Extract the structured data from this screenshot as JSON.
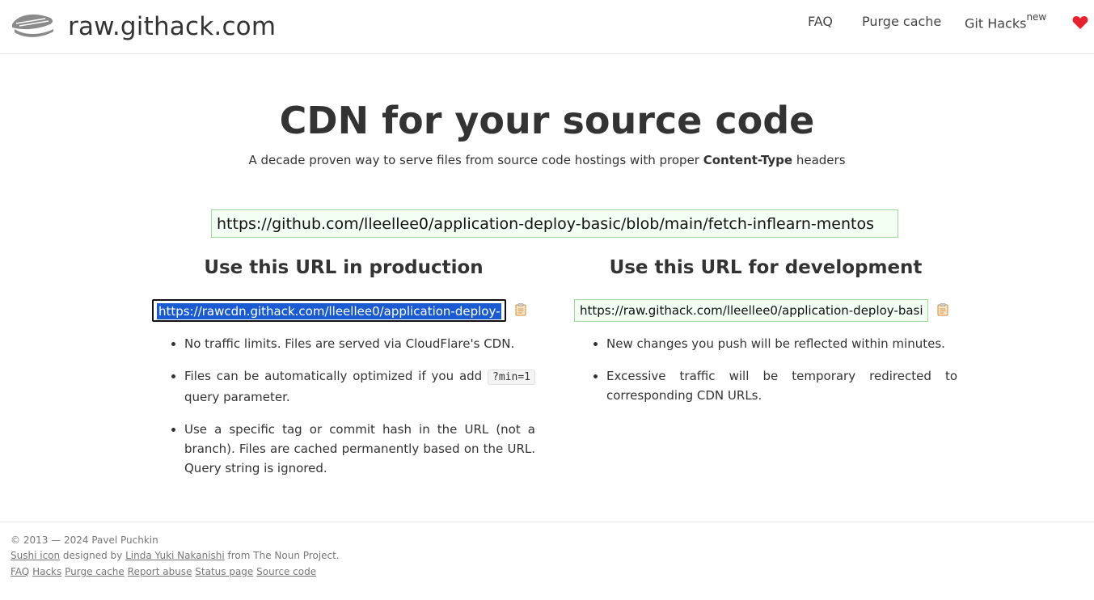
{
  "header": {
    "brand": "raw.githack.com",
    "nav": {
      "faq": "FAQ",
      "purge": "Purge cache",
      "git_hacks": "Git Hacks",
      "git_hacks_badge": "new"
    },
    "heart_color": "#e8212e"
  },
  "hero": {
    "title_bold": "CDN",
    "title_rest": " for your source code",
    "subtitle_pre": "A decade proven way to serve files from source code hostings with proper ",
    "subtitle_bold": "Content-Type",
    "subtitle_post": " headers"
  },
  "main_input": {
    "value": "https://github.com/lleellee0/application-deploy-basic/blob/main/fetch-inflearn-mentos"
  },
  "production": {
    "title": "Use this URL in production",
    "url": "https://rawcdn.githack.com/lleellee0/application-deploy-",
    "bullets": [
      "No traffic limits. Files are served via CloudFlare's CDN.",
      "Files can be automatically optimized if you add ",
      "Use a specific tag or commit hash in the URL (not a branch). Files are cached permanently based on the URL. Query string is ignored."
    ],
    "min_code": "?min=1",
    "min_suffix": " query parameter."
  },
  "development": {
    "title": "Use this URL for development",
    "url": "https://raw.githack.com/lleellee0/application-deploy-basi",
    "bullets": [
      "New changes you push will be reflected within minutes.",
      "Excessive traffic will be temporary redirected to corresponding CDN URLs."
    ]
  },
  "footer": {
    "copyright": "© 2013 — 2024 ",
    "author": "Pavel Puchkin",
    "sushi_icon": "Sushi icon",
    "designed_by": " designed by ",
    "designer": "Linda Yuki Nakanishi",
    "from": " from The Noun Project.",
    "links": [
      "FAQ",
      "Hacks",
      "Purge cache",
      "Report abuse",
      "Status page",
      "Source code"
    ]
  },
  "colors": {
    "selection": "#1b5bd1",
    "input_bg": "#f2fff2",
    "input_border": "#9fd99f"
  }
}
